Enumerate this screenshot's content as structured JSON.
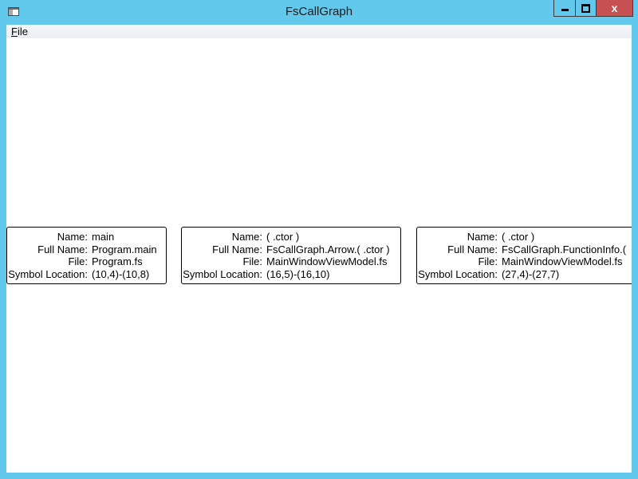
{
  "window": {
    "title": "FsCallGraph",
    "controls": {
      "minimize": "minimize",
      "maximize": "maximize",
      "close": "x"
    }
  },
  "menu": {
    "file_prefix": "F",
    "file_rest": "ile"
  },
  "field_labels": {
    "name": "Name:",
    "full_name": "Full Name:",
    "file": "File:",
    "symbol_location": "Symbol Location:"
  },
  "nodes": [
    {
      "name": "main",
      "full_name": "Program.main",
      "file": "Program.fs",
      "symbol_location": "(10,4)-(10,8)"
    },
    {
      "name": "( .ctor )",
      "full_name": "FsCallGraph.Arrow.( .ctor )",
      "file": "MainWindowViewModel.fs",
      "symbol_location": "(16,5)-(16,10)"
    },
    {
      "name": "( .ctor )",
      "full_name": "FsCallGraph.FunctionInfo.(",
      "file": "MainWindowViewModel.fs",
      "symbol_location": "(27,4)-(27,7)"
    }
  ],
  "colors": {
    "window_frame": "#62c8ec",
    "close_button": "#c75050",
    "client_background": "#ffffff"
  }
}
